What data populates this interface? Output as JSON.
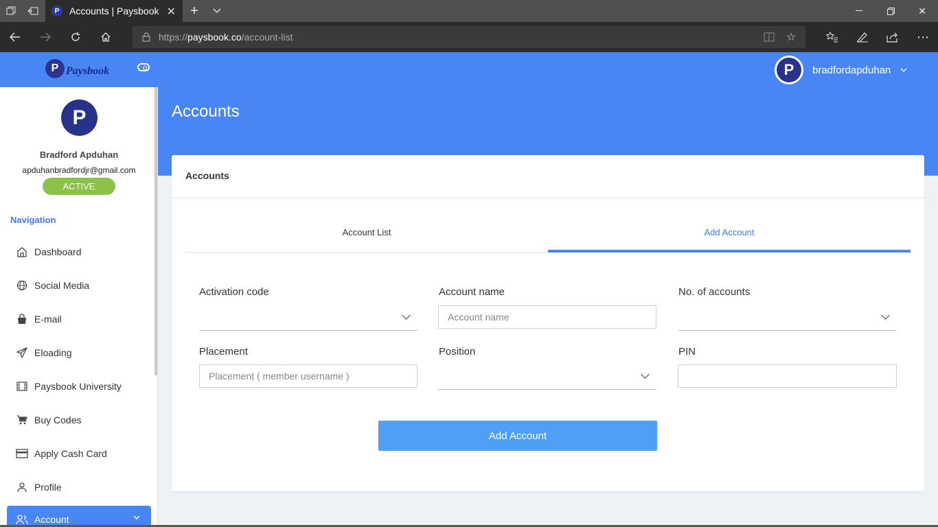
{
  "browser": {
    "tab_title": "Accounts | Paysbook",
    "url_prefix": "https://",
    "url_domain": "paysbook.co",
    "url_path": "/account-list"
  },
  "header": {
    "logo_text": "Paysbook",
    "username": "bradfordapduhan"
  },
  "sidebar": {
    "name": "Bradford Apduhan",
    "email": "apduhanbradfordjr@gmail.com",
    "status": "ACTIVE",
    "nav_heading": "Navigation",
    "items": [
      {
        "label": "Dashboard",
        "icon": "home-icon"
      },
      {
        "label": "Social Media",
        "icon": "globe-icon"
      },
      {
        "label": "E-mail",
        "icon": "shopping-bag-icon"
      },
      {
        "label": "Eloading",
        "icon": "send-icon"
      },
      {
        "label": "Paysbook University",
        "icon": "film-icon"
      },
      {
        "label": "Buy Codes",
        "icon": "cart-icon"
      },
      {
        "label": "Apply Cash Card",
        "icon": "credit-card-icon"
      },
      {
        "label": "Profile",
        "icon": "user-icon"
      }
    ],
    "active_item": {
      "label": "Account",
      "icon": "users-icon"
    }
  },
  "main": {
    "page_title": "Accounts",
    "card_title": "Accounts",
    "tabs": [
      {
        "label": "Account List",
        "active": false
      },
      {
        "label": "Add Account",
        "active": true
      }
    ],
    "form": {
      "activation_code_label": "Activation code",
      "account_name_label": "Account name",
      "account_name_placeholder": "Account name",
      "num_accounts_label": "No. of accounts",
      "placement_label": "Placement",
      "placement_placeholder": "Placement ( member username )",
      "position_label": "Position",
      "pin_label": "PIN",
      "submit_label": "Add Account"
    }
  },
  "colors": {
    "brand_blue": "#4886f5",
    "active_badge": "#8bc34a",
    "button_blue": "#4f9ef8",
    "logo_navy": "#28328a"
  }
}
